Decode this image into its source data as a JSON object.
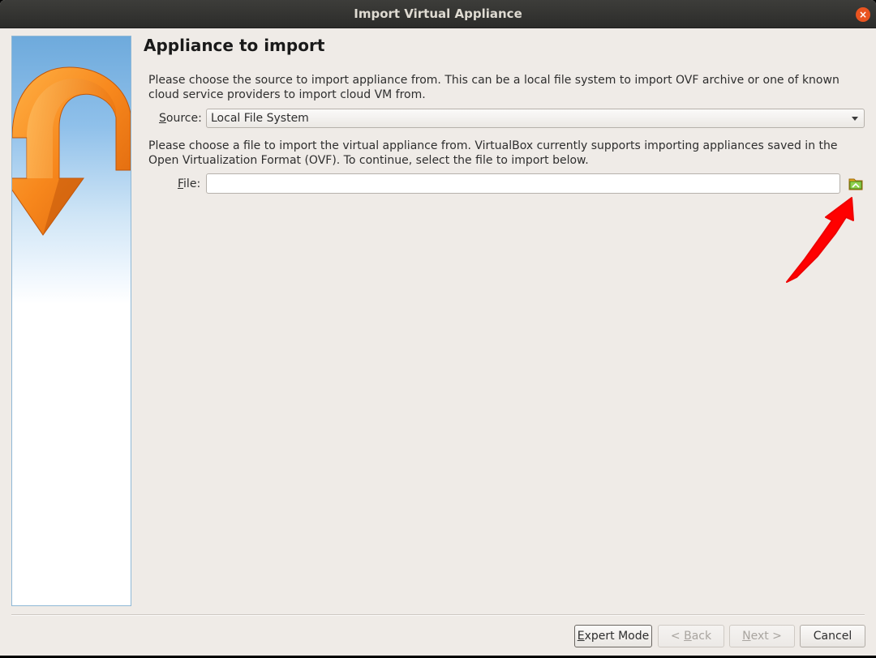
{
  "window": {
    "title": "Import Virtual Appliance",
    "close_glyph": "×"
  },
  "page": {
    "title": "Appliance to import",
    "source_description": "Please choose the source to import appliance from. This can be a local file system to import OVF archive or one of known cloud service providers to import cloud VM from.",
    "file_description": "Please choose a file to import the virtual appliance from. VirtualBox currently supports importing appliances saved in the Open Virtualization Format (OVF). To continue, select the file to import below."
  },
  "source": {
    "label_mnemonic": "S",
    "label_rest": "ource:",
    "selected": "Local File System"
  },
  "file": {
    "label_mnemonic": "F",
    "label_rest": "ile:",
    "value": "",
    "browse_icon": "folder-open-icon"
  },
  "buttons": {
    "expert_mnemonic": "E",
    "expert_rest": "xpert Mode",
    "back_prefix": "< ",
    "back_mnemonic": "B",
    "back_rest": "ack",
    "next_mnemonic": "N",
    "next_rest": "ext >",
    "cancel": "Cancel"
  },
  "colors": {
    "annotation_arrow": "#ff0000",
    "close_button": "#e95420",
    "titlebar": "#2f2f2d",
    "window_bg": "#efebe7"
  }
}
